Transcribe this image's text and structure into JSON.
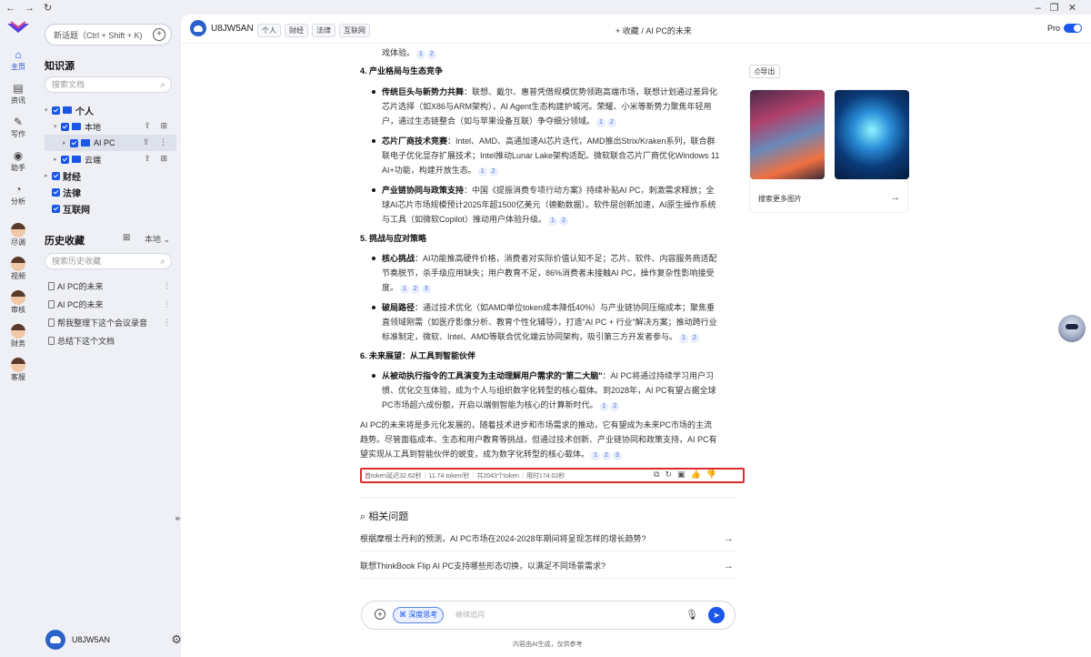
{
  "rail": {
    "items": [
      {
        "label": "主页",
        "icon": "home-icon",
        "glyph": "⌂"
      },
      {
        "label": "资讯",
        "icon": "news-icon",
        "glyph": "▤"
      },
      {
        "label": "写作",
        "icon": "write-icon",
        "glyph": "✎"
      },
      {
        "label": "助手",
        "icon": "bot-icon",
        "glyph": "◉"
      },
      {
        "label": "分析",
        "icon": "analyze-icon",
        "glyph": "◔"
      }
    ],
    "avatars": [
      "尽调",
      "视频",
      "审核",
      "财务",
      "客服"
    ]
  },
  "sidebar": {
    "new_topic": "新话题（Ctrl + Shift + K)",
    "kb_title": "知识源",
    "kb_search": "搜索文档",
    "tree": {
      "personal": "个人",
      "local": "本地",
      "aipc": "AI PC",
      "cloud": "云端",
      "finance": "财经",
      "law": "法律",
      "internet": "互联网"
    },
    "history_title": "历史收藏",
    "history_scope": "本地",
    "history_search": "搜索历史收藏",
    "history": [
      "AI PC的未来",
      "AI PC的未来",
      "帮我整理下这个会议录音",
      "总结下这个文档"
    ],
    "username": "U8JW5AN"
  },
  "topbar": {
    "username": "U8JW5AN",
    "tags": [
      "个人",
      "财经",
      "法律",
      "互联网"
    ],
    "crumb_fav": "收藏",
    "crumb_sep": "/",
    "crumb_title": "AI PC的未来",
    "pro": "Pro"
  },
  "content": {
    "l0": "戏体验。",
    "h4": "4. 产业格局与生态竞争",
    "b1_title": "传统巨头与新势力共舞",
    "b1_a": "：联想、戴尔、惠普凭借规模优势领跑高端市场，联想计划通过差异化",
    "b1_b": "芯片选择（如X86与ARM架构），AI Agent生态构建护城河。荣耀、小米等新势力聚焦年轻用",
    "b1_c": "户，通过生态链整合（如与苹果设备互联）争夺细分领域。",
    "b2_title": "芯片厂商技术竞赛",
    "b2_a": "：Intel、AMD、高通加速AI芯片迭代，AMD推出Strix/Kraken系列，联合群",
    "b2_b": "联电子优化显存扩展技术；Intel推动Lunar Lake架构适配。微软联合芯片厂商优化Windows 11",
    "b2_c": "AI+功能，构建开放生态。",
    "b3_title": "产业链协同与政策支持",
    "b3_a": "：中国《提振消费专项行动方案》持续补贴AI PC，刺激需求释放；全",
    "b3_b": "球AI芯片市场规模预计2025年超1500亿美元（德勤数据）。软件层创新加速，AI原生操作系统",
    "b3_c": "与工具（如微软Copilot）推动用户体验升级。",
    "h5": "5. 挑战与应对策略",
    "b4_title": "核心挑战",
    "b4_a": "：AI功能推高硬件价格，消费者对实际价值认知不足；芯片、软件、内容服务商适配",
    "b4_b": "节奏脱节，杀手级应用缺失；用户教育不足，86%消费者未接触AI PC，操作复杂性影响接受",
    "b4_c": "度。",
    "b5_title": "破局路径",
    "b5_a": "：通过技术优化（如AMD单位token成本降低40%）与产业链协同压缩成本；聚焦垂",
    "b5_b": "直领域刚需（如医疗影像分析、教育个性化辅导），打造\"AI PC + 行业\"解决方案；推动跨行业",
    "b5_c": "标准制定，微软、Intel、AMD等联合优化端云协同架构，吸引第三方开发者参与。",
    "h6": "6. 未来展望：从工具到智能伙伴",
    "b6_title": "从被动执行指令的工具演变为主动理解用户需求的\"第二大脑\"",
    "b6_a": "：AI PC将通过持续学习用户习",
    "b6_b": "惯、优化交互体验，成为个人与组织数字化转型的核心载体。到2028年，AI PC有望占据全球",
    "b6_c": "PC市场超六成份额，开启以端侧智能为核心的计算新时代。",
    "p1": "AI PC的未来将是多元化发展的，随着技术进步和市场需求的推动，它有望成为未来PC市场的主流",
    "p2": "趋势。尽管面临成本、生态和用户教育等挑战，但通过技术创新、产业链协同和政策支持，AI PC有",
    "p3": "望实现从工具到智能伙伴的蜕变，成为数字化转型的核心载体。"
  },
  "stats": {
    "first_token": "首token延迟32.62秒",
    "speed": "11.74 token/秒",
    "total": "共2043个token",
    "time": "用时174.02秒"
  },
  "related": {
    "title": "相关问题",
    "items": [
      "根据摩根士丹利的预测，AI PC市场在2024-2028年期间将呈现怎样的增长趋势?",
      "联想ThinkBook Flip AI PC支持哪些形态切换，以满足不同场景需求?"
    ]
  },
  "side": {
    "export": "导出",
    "more_images": "搜索更多图片"
  },
  "input": {
    "deep": "深度思考",
    "placeholder": "继续追问"
  },
  "footer": "内容由AI生成，仅供参考",
  "colors": {
    "accent": "#1a56e8",
    "highlight": "#e12a2a"
  }
}
